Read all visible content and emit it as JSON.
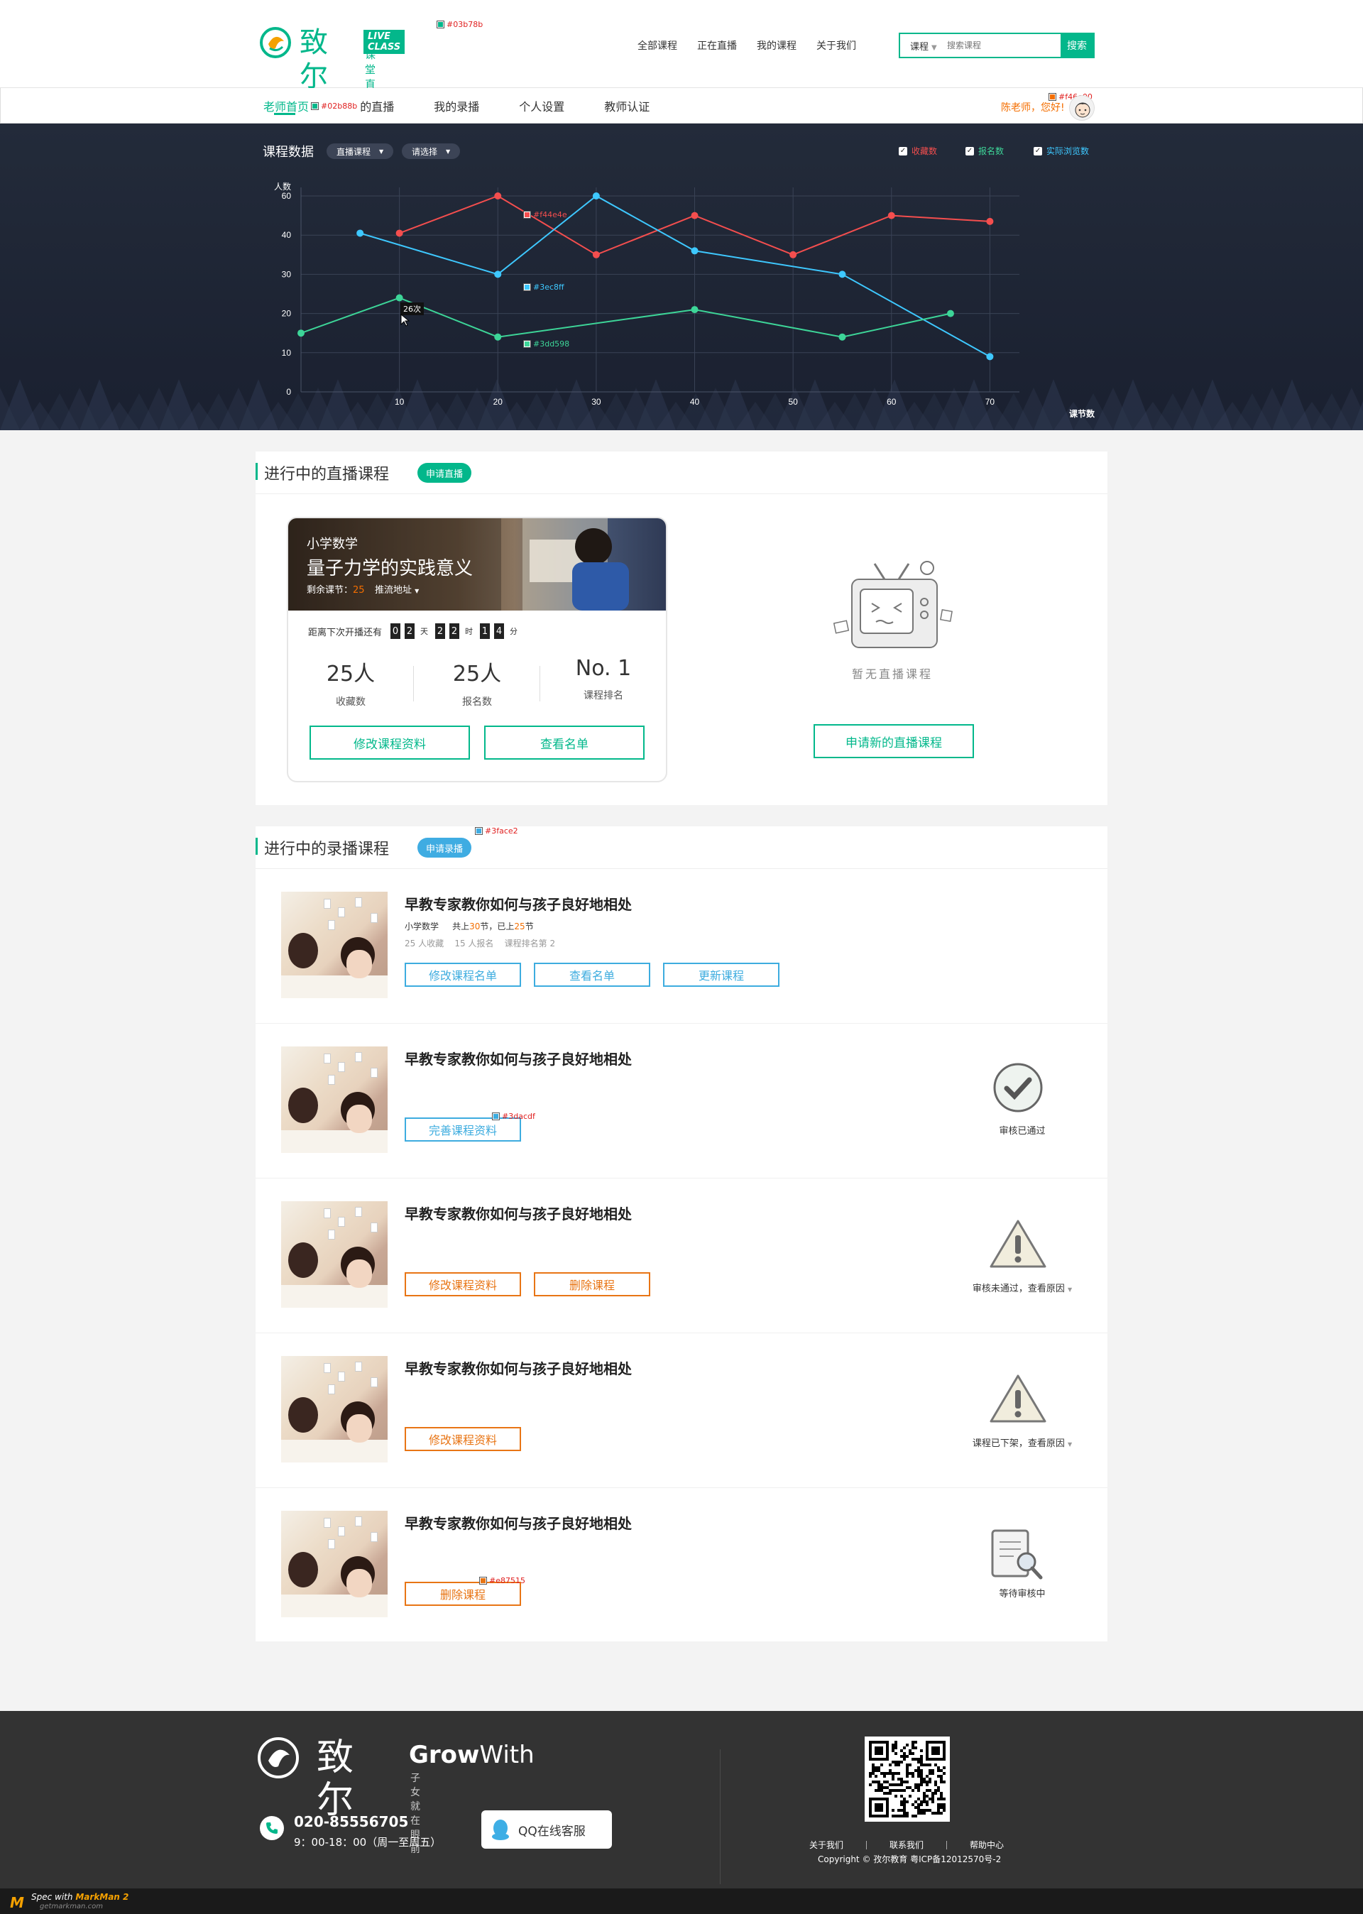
{
  "header": {
    "logo_text": "致尔",
    "logo_badge": "LIVE CLASS",
    "logo_sub": "课堂直播",
    "nav": [
      "全部课程",
      "正在直播",
      "我的课程",
      "关于我们"
    ],
    "search": {
      "type": "课程",
      "placeholder": "搜索课程",
      "button": "搜索"
    }
  },
  "subnav": {
    "items": [
      "老师首页",
      "的直播",
      "我的录播",
      "个人设置",
      "教师认证"
    ],
    "greeting": "陈老师，您好!"
  },
  "chart_panel": {
    "title": "课程数据",
    "dropdown1": "直播课程",
    "dropdown2": "请选择",
    "legend": [
      {
        "label": "收藏数",
        "color": "#f44e4e"
      },
      {
        "label": "报名数",
        "color": "#3dd598"
      },
      {
        "label": "实际浏览数",
        "color": "#3ec8ff"
      }
    ],
    "tooltip": "26次"
  },
  "chart_data": {
    "type": "line",
    "ylabel": "人数",
    "xlabel": "课节数",
    "x_ticks": [
      10,
      20,
      30,
      40,
      50,
      60,
      70
    ],
    "y_ticks": [
      0,
      10,
      20,
      30,
      40,
      60
    ],
    "series": [
      {
        "name": "收藏数",
        "color": "#f44e4e",
        "points": [
          [
            10,
            41
          ],
          [
            20,
            60
          ],
          [
            30,
            35
          ],
          [
            40,
            50
          ],
          [
            50,
            35
          ],
          [
            60,
            50
          ],
          [
            70,
            47
          ]
        ]
      },
      {
        "name": "实际浏览数",
        "color": "#3ec8ff",
        "points": [
          [
            6,
            41
          ],
          [
            20,
            30
          ],
          [
            30,
            60
          ],
          [
            40,
            36
          ],
          [
            55,
            30
          ],
          [
            70,
            9
          ]
        ]
      },
      {
        "name": "报名数",
        "color": "#3dd598",
        "points": [
          [
            0,
            15
          ],
          [
            10,
            24
          ],
          [
            20,
            14
          ],
          [
            40,
            21
          ],
          [
            55,
            14
          ],
          [
            66,
            20
          ]
        ]
      }
    ]
  },
  "live_section": {
    "title": "进行中的直播课程",
    "apply_pill": "申请直播",
    "card": {
      "subject": "小学数学",
      "title": "量子力学的实践意义",
      "remaining_label": "剩余课节：",
      "remaining_value": "25",
      "stream_label": "推流地址",
      "countdown_label": "距离下次开播还有",
      "days": [
        "0",
        "2"
      ],
      "day_unit": "天",
      "hours": [
        "2",
        "2"
      ],
      "hour_unit": "时",
      "minutes": [
        "1",
        "4"
      ],
      "minute_unit": "分",
      "stats": [
        {
          "value": "25人",
          "label": "收藏数"
        },
        {
          "value": "25人",
          "label": "报名数"
        },
        {
          "value": "No. 1",
          "label": "课程排名"
        }
      ],
      "btn_edit": "修改课程资料",
      "btn_list": "查看名单"
    },
    "empty_text": "暂无直播课程",
    "btn_apply_new": "申请新的直播课程"
  },
  "recorded_section": {
    "title": "进行中的录播课程",
    "apply_pill": "申请录播",
    "rows": [
      {
        "title": "早教专家教你如何与孩子良好地相处",
        "meta_subject": "小学数学",
        "meta_total_pre": "共上",
        "meta_total": "30",
        "meta_total_post": "节，已上",
        "meta_done": "25",
        "meta_done_post": "节",
        "stats": "25 人收藏    15 人报名    课程排名第 2",
        "buttons": [
          "修改课程名单",
          "查看名单",
          "更新课程"
        ]
      },
      {
        "title": "早教专家教你如何与孩子良好地相处",
        "buttons": [
          "完善课程资料"
        ],
        "status": "审核已通过"
      },
      {
        "title": "早教专家教你如何与孩子良好地相处",
        "buttons": [
          "修改课程资料",
          "删除课程"
        ],
        "status": "审核未通过，查看原因"
      },
      {
        "title": "早教专家教你如何与孩子良好地相处",
        "buttons": [
          "修改课程资料"
        ],
        "status": "课程已下架，查看原因"
      },
      {
        "title": "早教专家教你如何与孩子良好地相处",
        "buttons": [
          "删除课程"
        ],
        "status": "等待审核中"
      }
    ]
  },
  "footer": {
    "brand_zh": "致尔",
    "brand_en_bold": "Grow",
    "brand_en_light": "With",
    "tagline": "子女就在眼前",
    "phone": "020-85556705",
    "hours": "9：00-18：00（周一至周五）",
    "qq": "QQ在线客服",
    "links": [
      "关于我们",
      "联系我们",
      "帮助中心"
    ],
    "copyright": "Copyright © 孜尔教育  粤ICP备12012570号-2"
  },
  "markman": {
    "spec_with": "Spec with",
    "product": "MarkMan 2",
    "site": "getmarkman.com"
  },
  "spec_annotations": {
    "logo": "#03b78b",
    "subnav": "#02b88b",
    "greeting": "#f46e00",
    "red_line": "#f44e4e",
    "blue_line": "#3ec8ff",
    "green_line": "#3dd598",
    "pill_blue": "#3face2",
    "btn_blue": "#3dacdf",
    "btn_orange": "#e87515"
  }
}
